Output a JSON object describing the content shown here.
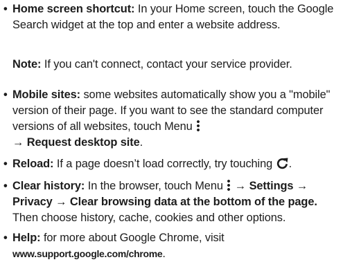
{
  "items": [
    {
      "title": "Home screen shortcut:",
      "text": "In your Home screen, touch the Google Search widget at the top and enter a website address."
    },
    {
      "note_label": "Note:",
      "note_text": "If you can't connect, contact your service provider."
    },
    {
      "title": "Mobile sites:",
      "text": "some websites automatically show you a \"mobile\" version of their page. If you want to see the standard computer versions of all websites, touch Menu",
      "arrow": "→",
      "action": "Request desktop site",
      "end": "."
    },
    {
      "title": "Reload:",
      "text": "If a page doesn’t load correctly, try touching",
      "end": "."
    },
    {
      "title": "Clear history:",
      "text": "In the browser, touch Menu",
      "arrow": "→",
      "settings": "Settings",
      "privacy": "Privacy",
      "clear_data": "Clear browsing data at the bottom of the page.",
      "text2": "Then choose history, cache, cookies and other options."
    },
    {
      "title": "Help:",
      "text": "for more about Google Chrome, visit",
      "url": "www.support.google.com/chrome",
      "end": "."
    }
  ],
  "bullet": "•",
  "icons": {
    "menu": "vertical-three-dot-menu-icon",
    "reload": "reload-arrow-icon"
  },
  "colors": {
    "text": "#1c1c1c"
  }
}
